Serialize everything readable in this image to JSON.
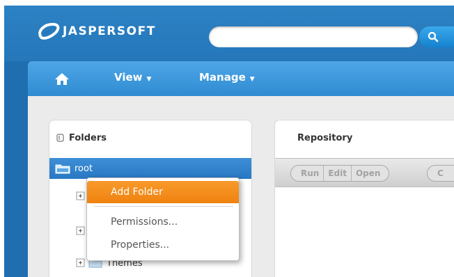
{
  "header": {
    "brand": "JASPERSOFT",
    "search": {
      "value": "",
      "placeholder": ""
    },
    "search_icon": "search-icon"
  },
  "nav": {
    "home_icon": "home-icon",
    "items": [
      {
        "label": "View"
      },
      {
        "label": "Manage"
      }
    ]
  },
  "folders": {
    "title": "Folders",
    "root": {
      "label": "root"
    },
    "visible_child": {
      "label": "Themes"
    }
  },
  "repository": {
    "title": "Repository",
    "toolbar": [
      "Run",
      "Edit",
      "Open"
    ],
    "toolbar_partial": "C"
  },
  "context_menu": {
    "items": [
      {
        "label": "Add Folder",
        "active": true
      },
      {
        "label": "Permissions..."
      },
      {
        "label": "Properties..."
      }
    ]
  },
  "colors": {
    "brand_blue": "#2577ba",
    "nav_blue": "#3f98dc",
    "selection_blue": "#2f80c8",
    "menu_highlight": "#f58b1c"
  }
}
